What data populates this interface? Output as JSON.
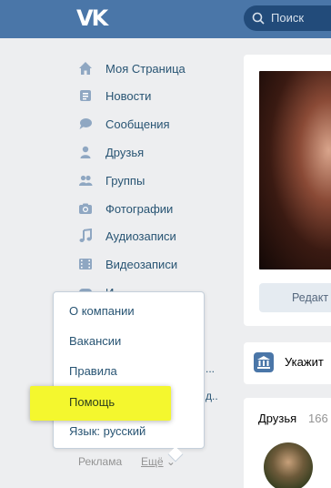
{
  "header": {
    "logo": "VK",
    "search_placeholder": "Поиск"
  },
  "sidebar": {
    "items": [
      {
        "label": "Моя Страница",
        "icon": "home-icon"
      },
      {
        "label": "Новости",
        "icon": "news-icon"
      },
      {
        "label": "Сообщения",
        "icon": "messages-icon"
      },
      {
        "label": "Друзья",
        "icon": "friends-icon"
      },
      {
        "label": "Группы",
        "icon": "groups-icon"
      },
      {
        "label": "Фотографии",
        "icon": "camera-icon"
      },
      {
        "label": "Аудиозаписи",
        "icon": "music-icon"
      },
      {
        "label": "Видеозаписи",
        "icon": "video-icon"
      },
      {
        "label": "И",
        "icon": "games-icon"
      }
    ],
    "partial_texts": [
      "...",
      "д.."
    ]
  },
  "popup": {
    "items": [
      {
        "label": "О компании"
      },
      {
        "label": "Вакансии"
      },
      {
        "label": "Правила"
      },
      {
        "label": "Помощь",
        "highlighted": true
      },
      {
        "label": "Язык: русский"
      }
    ]
  },
  "footer": {
    "ads": "Реклама",
    "more": "Ещё"
  },
  "profile": {
    "edit_button": "Редакт"
  },
  "hint": {
    "text": "Укажит"
  },
  "friends": {
    "title": "Друзья",
    "count": "166"
  },
  "colors": {
    "header": "#4a76a8",
    "link": "#285473",
    "highlight": "#f4f72e",
    "background": "#edeef0"
  }
}
